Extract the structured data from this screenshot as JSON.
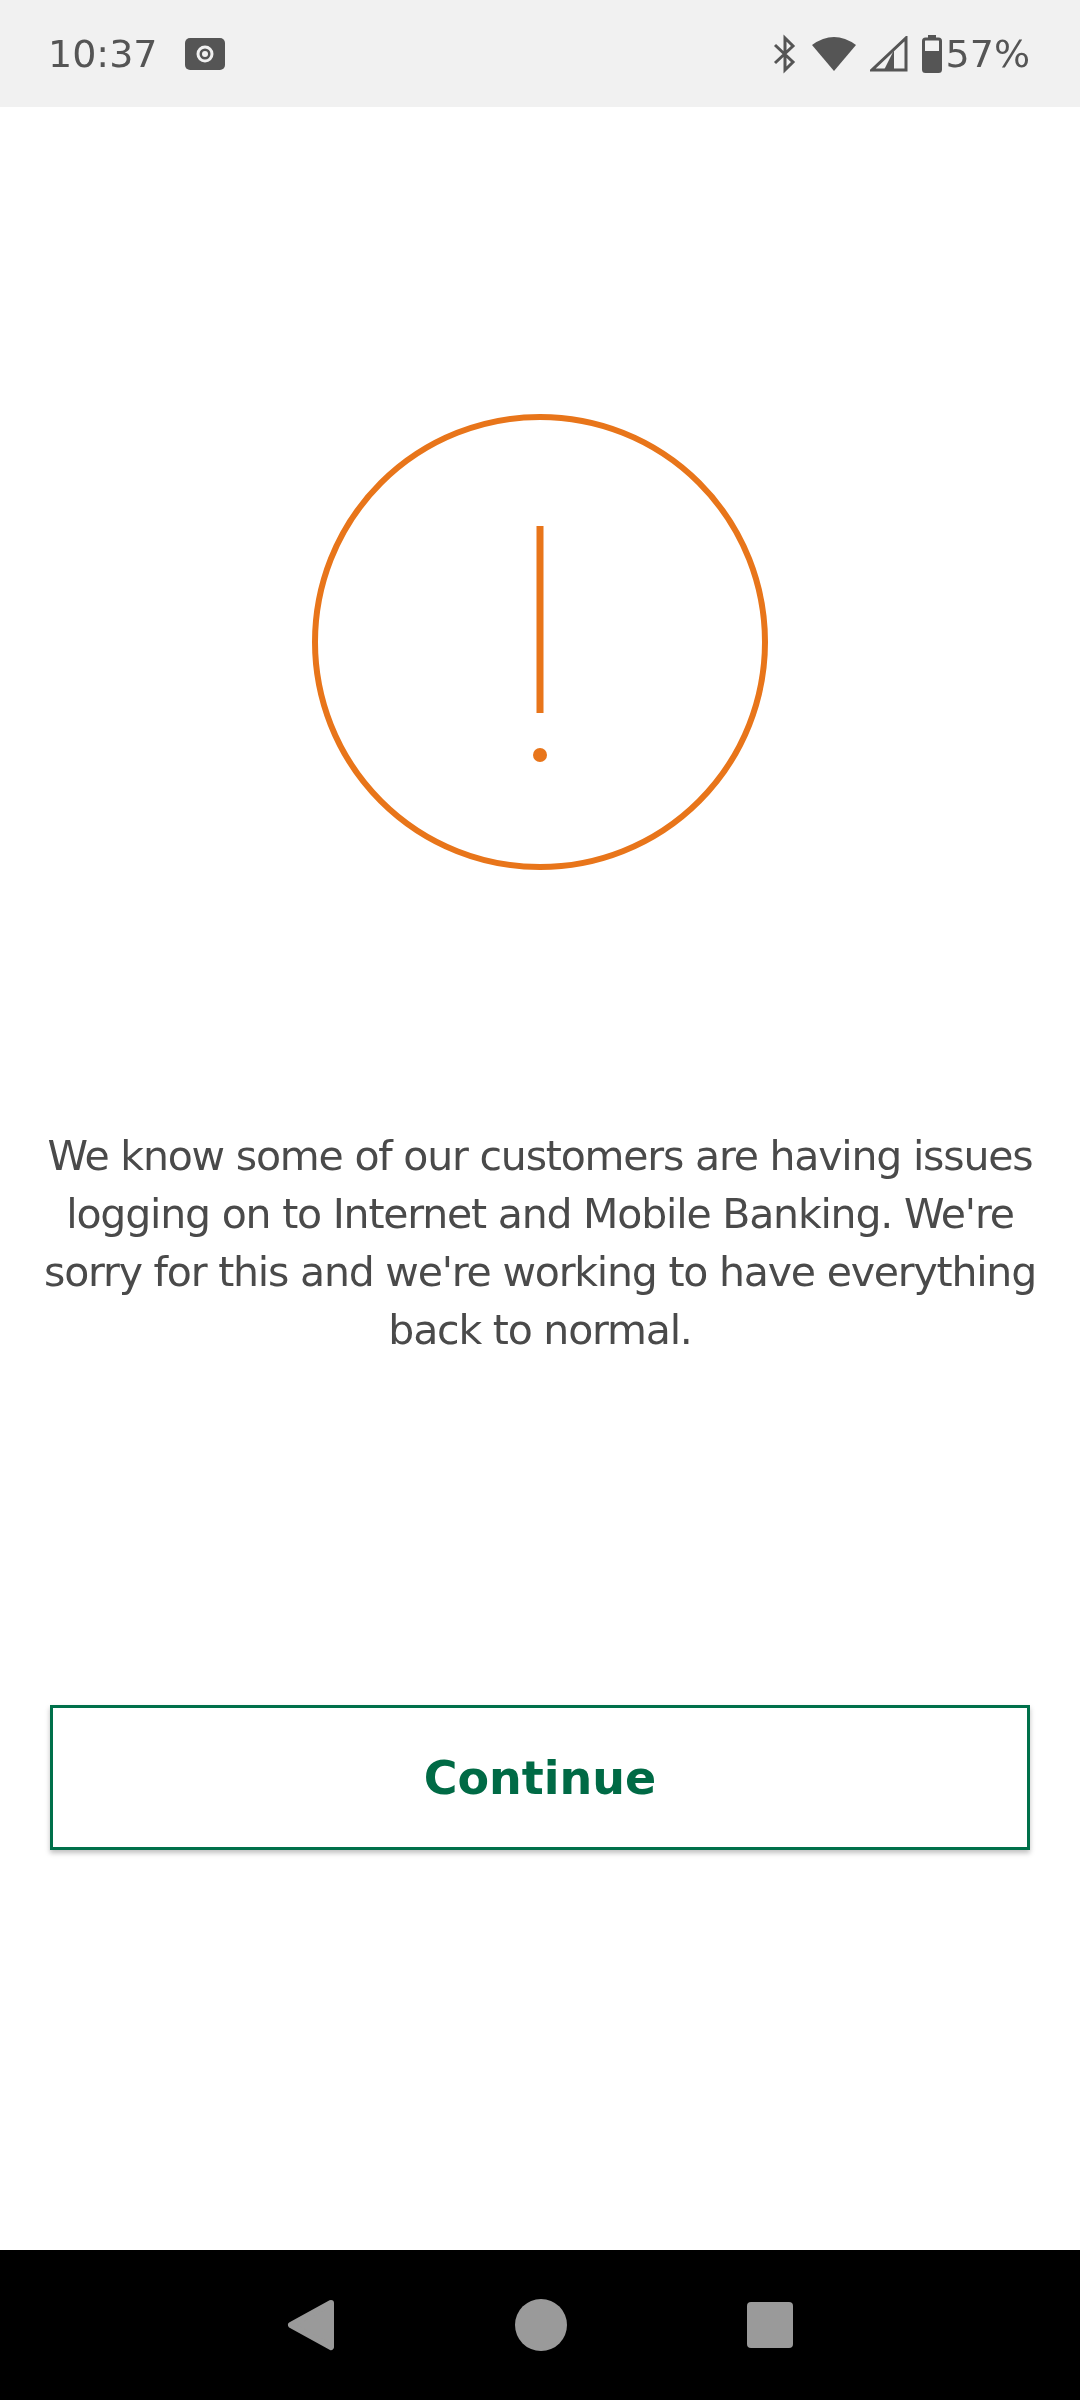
{
  "status_bar": {
    "time": "10:37",
    "battery": "57%"
  },
  "message": "We know some of our customers are having issues logging on to Internet and Mobile Banking. We're sorry for this and we're working to have everything back to normal.",
  "button": {
    "label": "Continue"
  }
}
